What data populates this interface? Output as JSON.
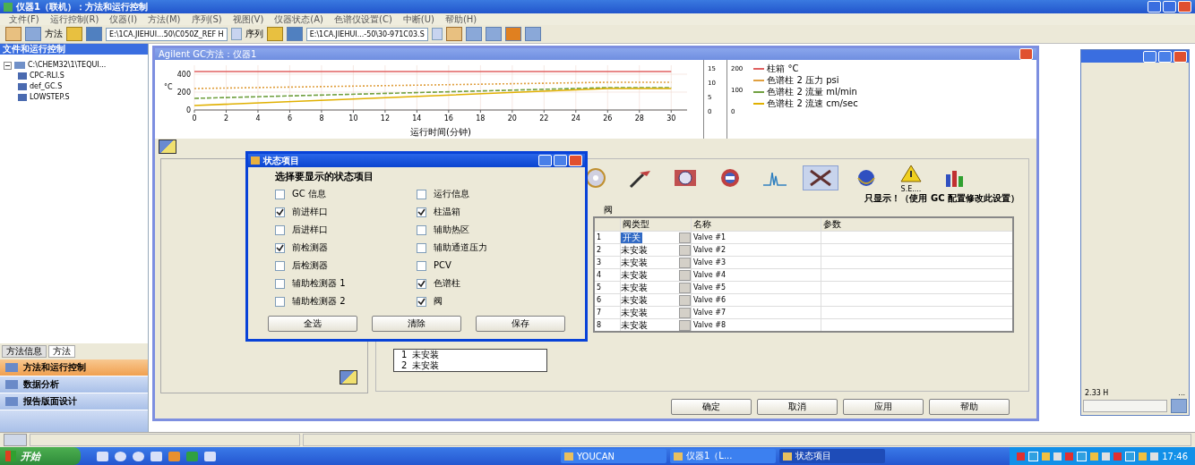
{
  "window": {
    "title": "仪器1（联机）：方法和运行控制"
  },
  "menu": [
    "文件(F)",
    "运行控制(R)",
    "仪器(I)",
    "方法(M)",
    "序列(S)",
    "视图(V)",
    "仪器状态(A)",
    "色谱仪设置(C)",
    "中断(U)",
    "帮助(H)"
  ],
  "toolbar": {
    "method_label": "方法",
    "method_path": "E:\\1CA.JIEHUI...50\\C050Z_REF H",
    "sequence_label": "序列",
    "sequence_path": "E:\\1CA.JIEHUI...-50\\30-971C03.S"
  },
  "explorer": {
    "title": "文件和运行控制",
    "tree": [
      {
        "label": "C:\\CHEM32\\1\\TEQUI...",
        "expanded": true,
        "children": [
          {
            "label": "CPC-RLI.S"
          },
          {
            "label": "def_GC.S"
          },
          {
            "label": "LOWSTEP.S"
          }
        ]
      }
    ],
    "tabs": [
      {
        "label": "方法信息",
        "selected": false
      },
      {
        "label": "方法",
        "selected": true
      }
    ],
    "nav": [
      {
        "label": "方法和运行控制",
        "selected": true
      },
      {
        "label": "数据分析",
        "selected": false
      },
      {
        "label": "报告版面设计",
        "selected": false
      }
    ]
  },
  "method_window": {
    "title": "Agilent GC方法：仪器1",
    "chart_data": {
      "type": "line",
      "grid": true,
      "xlabel": "运行时间(分钟)",
      "ylabel": "°C",
      "x": [
        0,
        26,
        30
      ],
      "xlim": [
        0,
        31
      ],
      "ylim": [
        0,
        500
      ],
      "xticks": [
        0,
        2,
        4,
        6,
        8,
        10,
        12,
        14,
        16,
        18,
        20,
        22,
        24,
        26,
        28,
        30
      ],
      "yticks": [
        0,
        200,
        400
      ],
      "series": [
        {
          "name": "柱箱 °C",
          "color": "#e06060",
          "line_style": "solid",
          "values": [
            430,
            430,
            430
          ]
        },
        {
          "name": "色谱柱 2 压力 psi",
          "color": "#e0a040",
          "line_style": "dotted",
          "values": [
            240,
            310,
            310
          ]
        },
        {
          "name": "色谱柱 2 流量 ml/min",
          "color": "#70a040",
          "line_style": "dashed",
          "values": [
            130,
            250,
            250
          ]
        },
        {
          "name": "色谱柱 2 流速 cm/sec",
          "color": "#e0b000",
          "line_style": "solid",
          "values": [
            50,
            240,
            240
          ]
        }
      ]
    },
    "side_axes": [
      {
        "ticks": [
          "15",
          "10",
          "5",
          "0"
        ]
      },
      {
        "ticks": [
          "200",
          "100",
          "0"
        ]
      }
    ],
    "icons": [
      {
        "selected": false
      },
      {
        "selected": false
      },
      {
        "selected": false
      },
      {
        "selected": false
      },
      {
        "selected": false
      },
      {
        "selected": true
      },
      {
        "selected": false
      },
      {
        "selected": false
      },
      {
        "selected": false
      }
    ],
    "warning_caption": "S.E....",
    "note": "只显示！（使用 GC 配置修改此设置）",
    "section": "阀",
    "table": {
      "columns": [
        "阀类型",
        "名称",
        "参数"
      ],
      "rows": [
        {
          "index": "1",
          "type": "开关",
          "name": "Valve #1",
          "selected": true
        },
        {
          "index": "2",
          "type": "未安装",
          "name": "Valve #2",
          "selected": false
        },
        {
          "index": "3",
          "type": "未安装",
          "name": "Valve #3",
          "selected": false
        },
        {
          "index": "4",
          "type": "未安装",
          "name": "Valve #4",
          "selected": false
        },
        {
          "index": "5",
          "type": "未安装",
          "name": "Valve #5",
          "selected": false
        },
        {
          "index": "6",
          "type": "未安装",
          "name": "Valve #6",
          "selected": false
        },
        {
          "index": "7",
          "type": "未安装",
          "name": "Valve #7",
          "selected": false
        },
        {
          "index": "8",
          "type": "未安装",
          "name": "Valve #8",
          "selected": false
        }
      ]
    },
    "sub_list": [
      {
        "index": "1",
        "type": "未安装"
      },
      {
        "index": "2",
        "type": "未安装"
      }
    ],
    "buttons": [
      "确定",
      "取消",
      "应用",
      "帮助"
    ]
  },
  "dialog": {
    "title": "状态项目",
    "heading": "选择要显示的状态项目",
    "items": [
      {
        "label": "GC 信息",
        "checked": false
      },
      {
        "label": "运行信息",
        "checked": false
      },
      {
        "label": "前进样口",
        "checked": true
      },
      {
        "label": "柱温箱",
        "checked": true
      },
      {
        "label": "后进样口",
        "checked": false
      },
      {
        "label": "辅助热区",
        "checked": false
      },
      {
        "label": "前检测器",
        "checked": true
      },
      {
        "label": "辅助通道压力",
        "checked": false
      },
      {
        "label": "后检测器",
        "checked": false
      },
      {
        "label": "PCV",
        "checked": false
      },
      {
        "label": "辅助检测器 1",
        "checked": false
      },
      {
        "label": "色谱柱",
        "checked": true
      },
      {
        "label": "辅助检测器 2",
        "checked": false
      },
      {
        "label": "阀",
        "checked": true
      }
    ],
    "buttons": [
      "全选",
      "清除",
      "保存"
    ]
  },
  "right_window": {
    "reading": "2.33 H",
    "more": "..."
  },
  "taskbar": {
    "start": "开始",
    "tasks": [
      {
        "label": "YOUCAN",
        "selected": false
      },
      {
        "label": "仪器1（L...",
        "selected": false
      },
      {
        "label": "状态项目",
        "selected": true
      }
    ],
    "time": "17:46"
  }
}
